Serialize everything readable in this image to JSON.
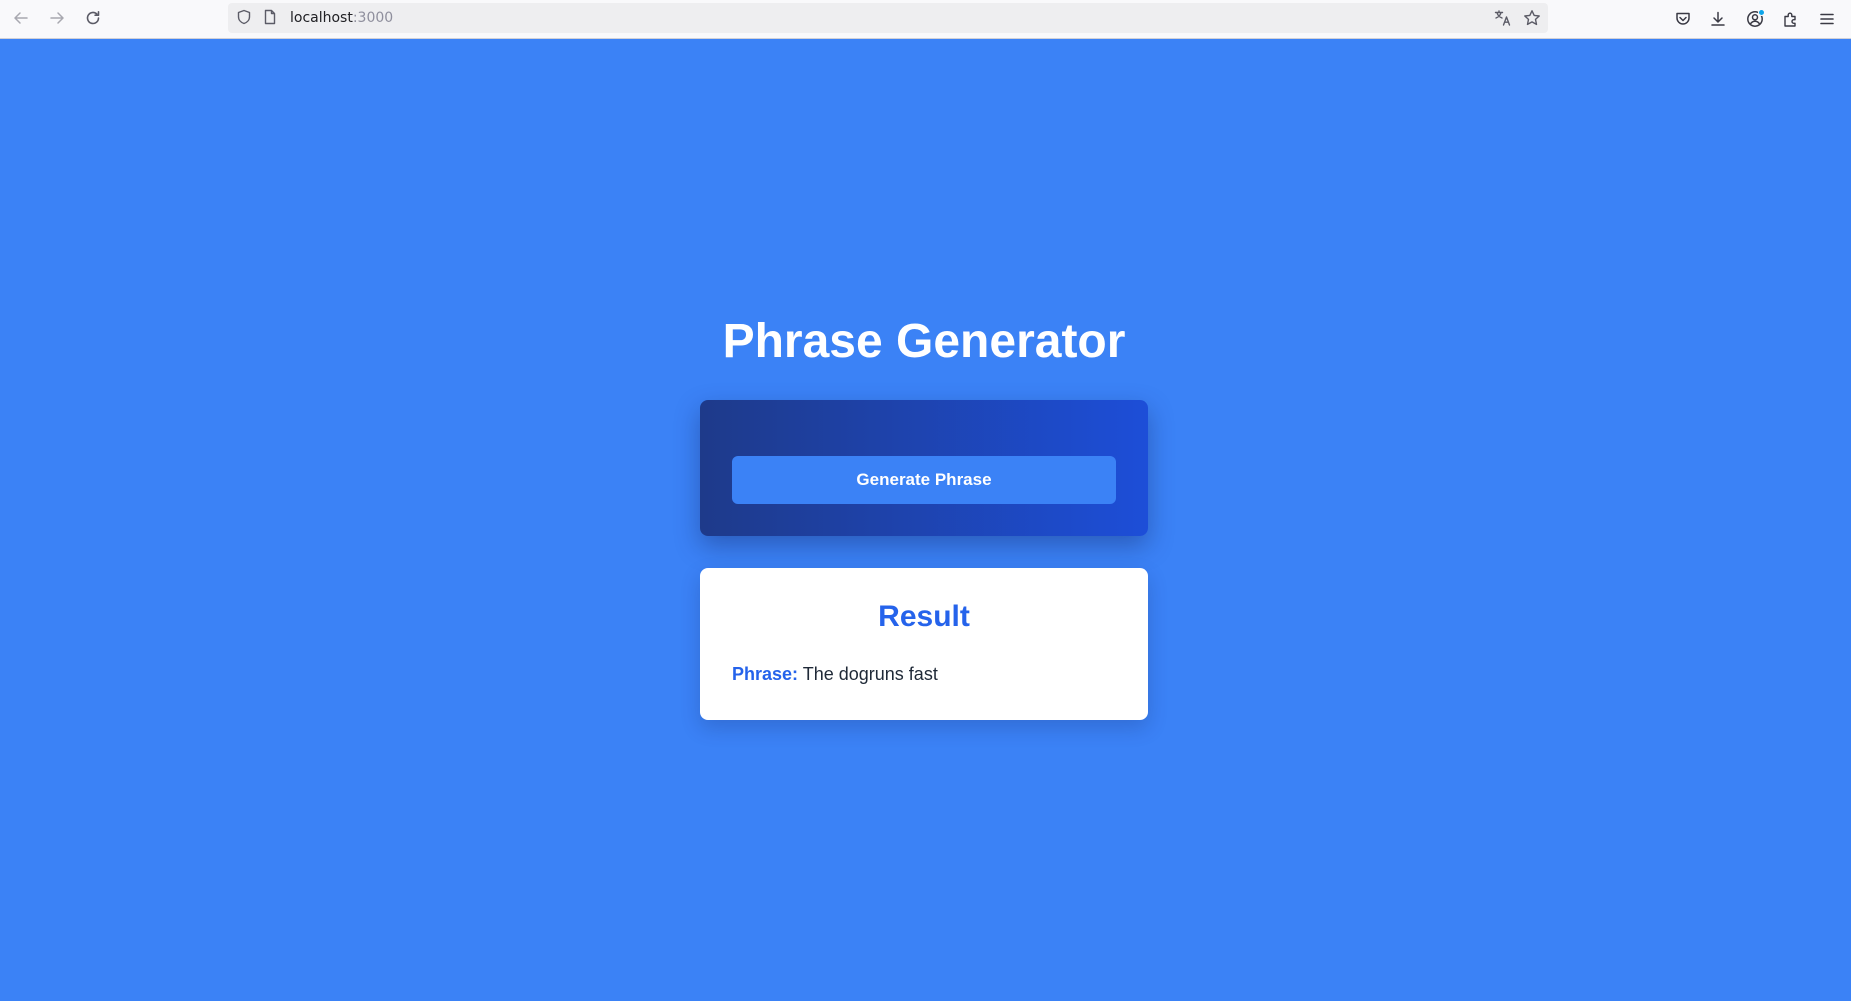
{
  "browser": {
    "url_host": "localhost",
    "url_port": ":3000",
    "icons": [
      "back-arrow-icon",
      "forward-arrow-icon",
      "reload-icon",
      "shield-icon",
      "page-icon",
      "translate-icon",
      "bookmark-star-icon",
      "pocket-icon",
      "download-icon",
      "account-icon",
      "extensions-icon",
      "menu-icon"
    ]
  },
  "page": {
    "title": "Phrase Generator",
    "generate_button_label": "Generate Phrase",
    "result": {
      "heading": "Result",
      "label": "Phrase:",
      "value": "The dogruns fast"
    }
  },
  "colors": {
    "background": "#3b82f6",
    "card_gradient_start": "#1e3a8a",
    "card_gradient_end": "#1d4ed8",
    "accent": "#2563eb"
  }
}
